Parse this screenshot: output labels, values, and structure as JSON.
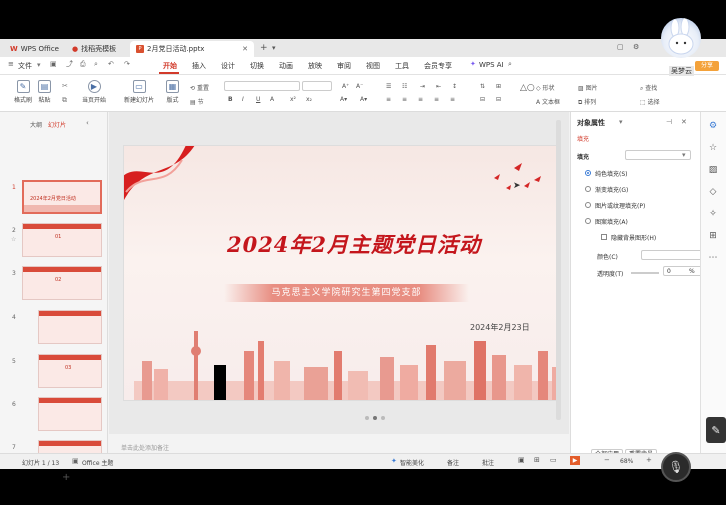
{
  "titlebar": {
    "tabs": [
      {
        "label": "WPS Office",
        "icon": "wps-logo-icon"
      },
      {
        "label": "找稻壳模板",
        "icon": "docer-icon"
      },
      {
        "label": "2月党日活动.pptx",
        "icon": "ppt-file-icon"
      }
    ]
  },
  "menubar": {
    "file": "文件",
    "items": [
      "开始",
      "插入",
      "设计",
      "切换",
      "动画",
      "放映",
      "审阅",
      "视图",
      "工具",
      "会员专享"
    ],
    "active": "开始",
    "ai": "WPS AI"
  },
  "ribbon": {
    "format_painter": "格式刷",
    "paste": "粘贴",
    "start_from_current": "当页开始",
    "new_slide": "新建幻灯片",
    "layout": "版式",
    "section": "节",
    "reset": "重置",
    "shape": "形状",
    "picture": "图片",
    "find": "查找",
    "textbox": "文本框",
    "arrange": "排列",
    "select": "选择"
  },
  "user": {
    "name": "吴梦云",
    "share": "分享"
  },
  "left_panel": {
    "tab_outline": "大纲",
    "tab_slides": "幻灯片",
    "slide_numbers": [
      "1",
      "2",
      "3",
      "4",
      "5",
      "6",
      "7"
    ],
    "thumb_texts": [
      "2024年2月党日活动",
      "01",
      "02",
      "",
      "03",
      "",
      ""
    ],
    "add": "+"
  },
  "slide": {
    "title": "2024年2月主题党日活动",
    "subtitle": "马克思主义学院研究生第四党支部",
    "date": "2024年2月23日"
  },
  "notes_placeholder": "单击此处添加备注",
  "right_panel": {
    "title": "对象属性",
    "fill_tab": "填充",
    "fill_label": "填充",
    "options": [
      "纯色填充(S)",
      "渐变填充(G)",
      "图片或纹理填充(P)",
      "图案填充(A)"
    ],
    "selected_option": 0,
    "hide_bg": "隐藏背景图形(H)",
    "color_label": "颜色(C)",
    "transparency_label": "透明度(T)",
    "transparency_value": "0",
    "transparency_unit": "%",
    "apply_all": "全部应用",
    "reset_bg": "重置背景"
  },
  "statusbar": {
    "slide_info": "幻灯片 1 / 13",
    "theme": "Office 主题",
    "smart_beautify": "智能美化",
    "notes": "备注",
    "comments": "批注",
    "zoom": "68%"
  },
  "colors": {
    "accent": "#d23a2a",
    "title_red": "#c4161c",
    "share_orange": "#f4a23a"
  }
}
